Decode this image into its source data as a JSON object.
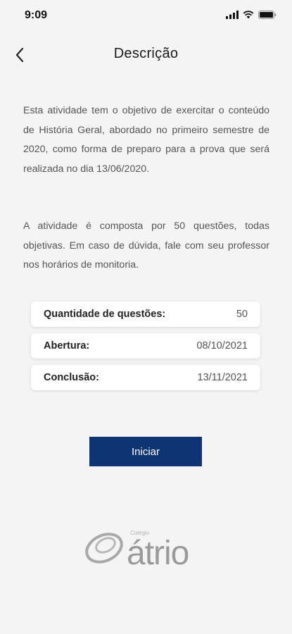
{
  "status_bar": {
    "time": "9:09"
  },
  "nav": {
    "title": "Descrição",
    "back_icon": "chevron-left-icon"
  },
  "description": {
    "paragraph_1": "Esta atividade tem o objetivo de exercitar o conteúdo de História Geral, abordado no primeiro semestre de 2020, como forma de preparo para a prova que será realizada no dia 13/06/2020.",
    "paragraph_2": "A atividade é composta por 50 questões, todas objetivas. Em caso de dúvida, fale com seu professor nos horários de monitoria."
  },
  "info": [
    {
      "label": "Quantidade de questões:",
      "value": "50"
    },
    {
      "label": "Abertura:",
      "value": "08/10/2021"
    },
    {
      "label": "Conclusão:",
      "value": "13/11/2021"
    }
  ],
  "start_button": {
    "label": "Iniciar"
  },
  "logo": {
    "small_text": "Colégio",
    "wordmark": "átrio"
  },
  "colors": {
    "primary": "#0e3473",
    "background": "#f4f4f4",
    "card": "#ffffff"
  }
}
